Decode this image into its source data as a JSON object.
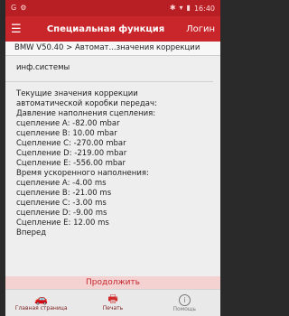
{
  "status_bar": {
    "left_icons": [
      "app-g-icon",
      "gear-icon"
    ],
    "time": "16:40"
  },
  "header": {
    "title": "Специальная функция",
    "login_label": "Логин"
  },
  "breadcrumb": "BMW V50.40 > Автомат...значения коррекции",
  "section_label": "инф.системы",
  "lines": [
    "Текущие значения коррекции",
    "автоматической коробки передач:",
    "Давление наполнения сцепления:",
    "сцепление A: -82.00 mbar",
    "сцепление B: 10.00 mbar",
    "Сцепление C: -270.00 mbar",
    "Сцепление D: -219.00 mbar",
    "Сцепление E: -556.00 mbar",
    "Время ускоренного наполнения:",
    "сцепление A: -4.00 ms",
    "сцепление B: -21.00 ms",
    "сцепление C: -3.00 ms",
    "сцепление D: -9.00 ms",
    "Сцепление E: 12.00 ms",
    "Вперед"
  ],
  "continue_label": "Продолжить",
  "bottom_nav": {
    "home_label": "Главная страница",
    "print_label": "Печать",
    "help_label": "Помощь"
  },
  "colors": {
    "header_red": "#c8262b",
    "status_red": "#b71f24",
    "continue_bg": "#f4d2d2"
  }
}
